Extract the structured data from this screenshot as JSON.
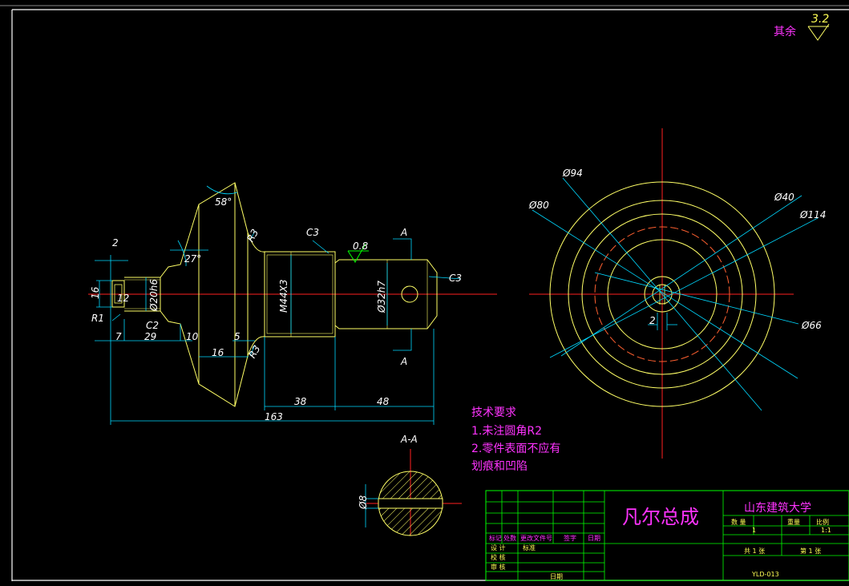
{
  "colors": {
    "background": "#000000",
    "outline": "#ffff66",
    "centerline": "#ff2020",
    "dimension": "#00d8ff",
    "text_magenta": "#ff33ff",
    "border": "#ffffff",
    "title_grid": "#00ff00"
  },
  "surface_finish": {
    "label": "其余",
    "value": "3.2"
  },
  "side_view": {
    "dims": {
      "d2": "2",
      "d16": "16",
      "d12": "12",
      "r1": "R1",
      "d7": "7",
      "d29": "29",
      "d10": "10",
      "d16b": "16",
      "d5": "5",
      "c2": "C2",
      "d20": "Ø20h6",
      "a58": "58°",
      "a27": "27°",
      "r3": "R3",
      "r3b": "R3",
      "c3a": "C3",
      "c3b": "C3",
      "m44": "M44X3",
      "d32": "Ø32h7",
      "rough": "0.8",
      "sec_a1": "A",
      "sec_a2": "A",
      "d38": "38",
      "d48": "48",
      "d163": "163"
    }
  },
  "front_view": {
    "dims": {
      "d94": "Ø94",
      "d80": "Ø80",
      "d40": "Ø40",
      "d114": "Ø114",
      "d66": "Ø66",
      "d2": "2"
    }
  },
  "section_view": {
    "title": "A-A",
    "d8": "Ø8"
  },
  "tech_requirements": {
    "title": "技术要求",
    "line1": "1.未注圆角R2",
    "line2": "2.零件表面不应有",
    "line3": "划痕和凹陷"
  },
  "title_block": {
    "part_name": "凡尔总成",
    "school": "山东建筑大学",
    "weight_label": "数 量",
    "mass_label": "重量",
    "scale_label": "比例",
    "quantity": "1",
    "scale": "1:1",
    "sheets_total": "共 1 张",
    "sheet_no": "第 1 张",
    "drawing_no": "YLD-013",
    "row_labels": [
      "标记",
      "处数",
      "更改文件号",
      "签字",
      "日期"
    ],
    "design": "设 计",
    "standard": "标准",
    "check": "校 核",
    "review": "审 核",
    "date": "日期"
  }
}
